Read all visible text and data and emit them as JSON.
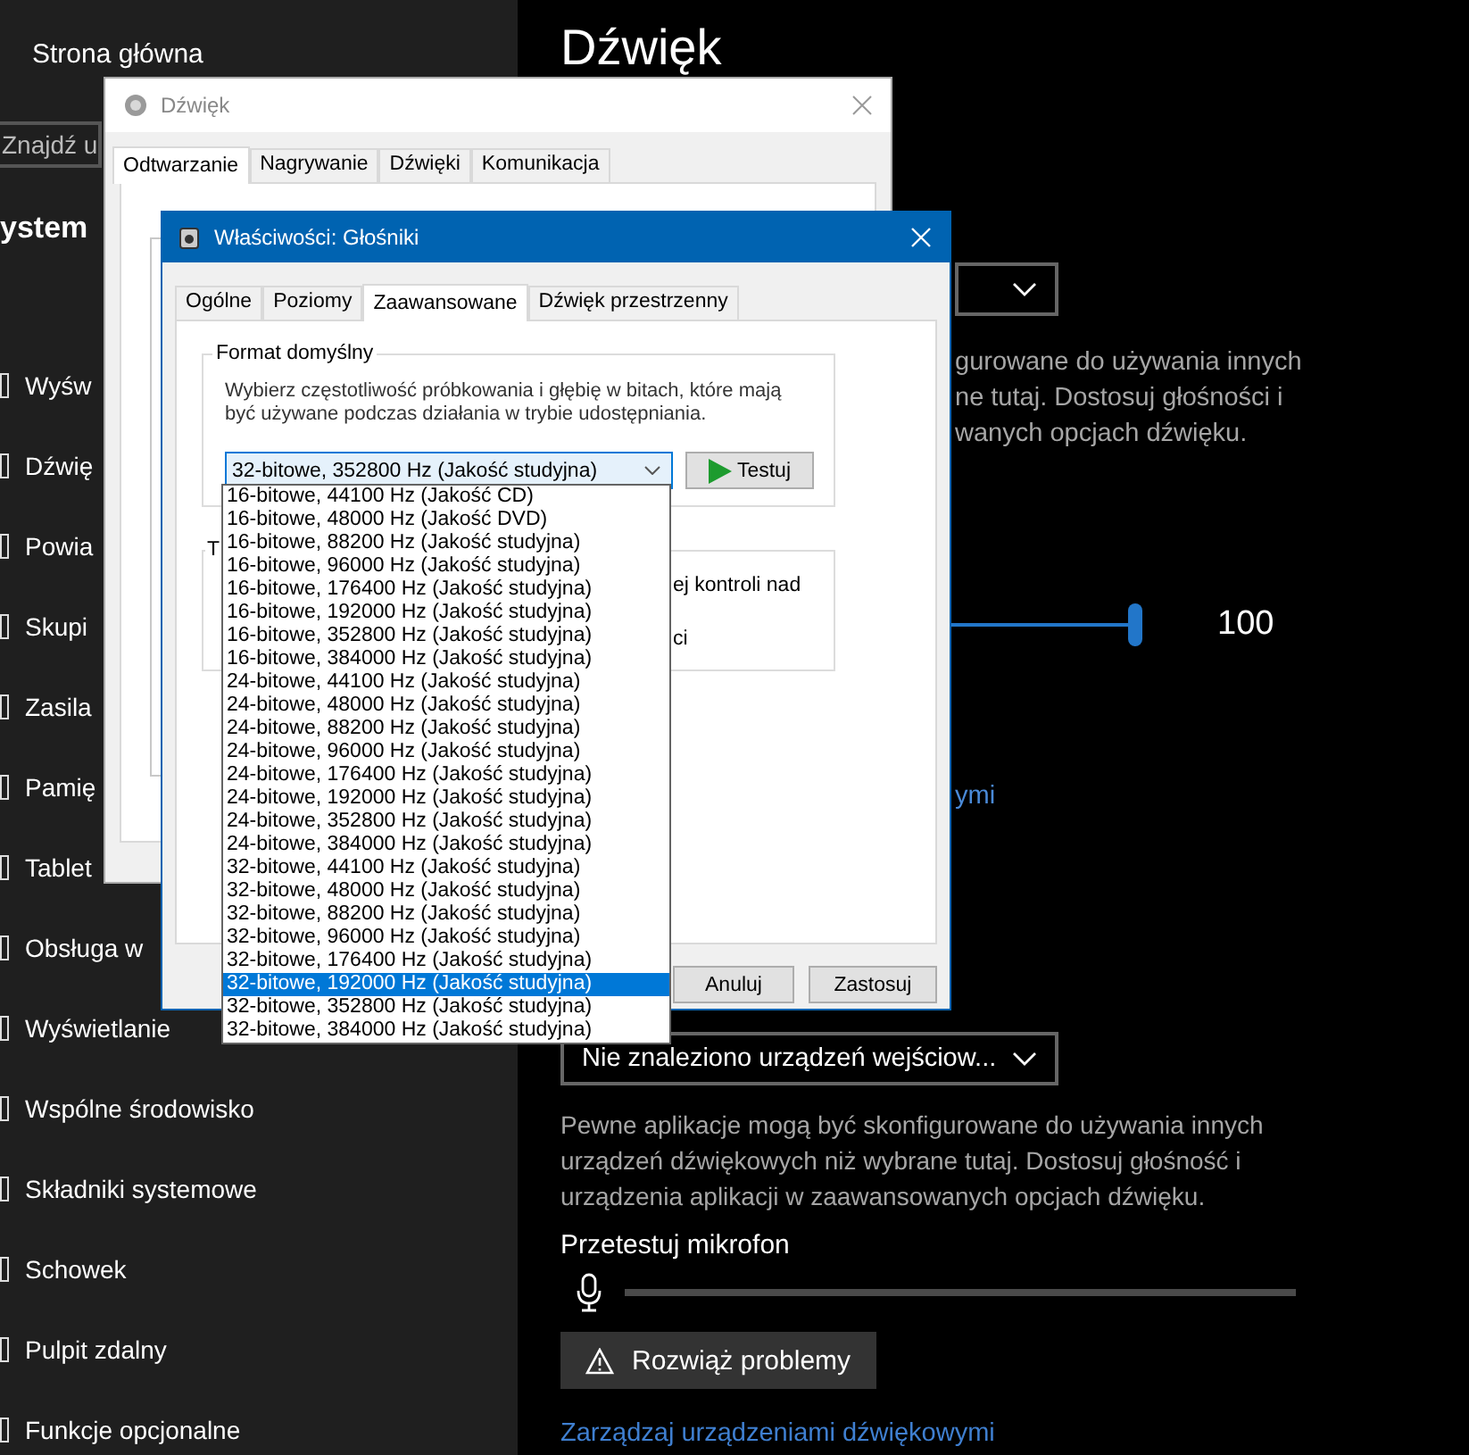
{
  "settings": {
    "home": "Strona główna",
    "search": {
      "placeholder": "Znajdź u"
    },
    "section": "ystem",
    "sidebar_items": [
      "Wyśw",
      "Dźwię",
      "Powia",
      "Skupi",
      "Zasila",
      "Pamię",
      "Tablet",
      "Obsługa w",
      "Wyświetlanie",
      "Wspólne środowisko",
      "Składniki systemowe",
      "Schowek",
      "Pulpit zdalny",
      "Funkcje opcjonalne"
    ],
    "title": "Dźwięk",
    "output_note_lines": [
      "gurowane do używania innych",
      "ne tutaj. Dostosuj głośności i",
      "wanych opcjach dźwięku."
    ],
    "volume": {
      "level": 1,
      "reading": "100"
    },
    "link_fragment": "ymi",
    "input_device": "Nie znaleziono urządzeń wejściow...",
    "input_note": "Pewne aplikacje mogą być skonfigurowane do używania innych urządzeń dźwiękowych niż wybrane tutaj. Dostosuj głośność i urządzenia aplikacji w zaawansowanych opcjach dźwięku.",
    "mic_test": {
      "label": "Przetestuj mikrofon"
    },
    "troubleshoot_button": "Rozwiąż problemy",
    "manage_link": "Zarządzaj urządzeniami dźwiękowymi"
  },
  "sound_window": {
    "title": "Dźwięk",
    "tabs": [
      {
        "label": "Odtwarzanie",
        "selected": true
      },
      {
        "label": "Nagrywanie",
        "selected": false
      },
      {
        "label": "Dźwięki",
        "selected": false
      },
      {
        "label": "Komunikacja",
        "selected": false
      }
    ]
  },
  "properties_window": {
    "title": "Właściwości: Głośniki",
    "tabs": [
      {
        "label": "Ogólne",
        "selected": false
      },
      {
        "label": "Poziomy",
        "selected": false
      },
      {
        "label": "Zaawansowane",
        "selected": true
      },
      {
        "label": "Dźwięk przestrzenny",
        "selected": false
      }
    ],
    "format_group": {
      "legend": "Format domyślny",
      "description": "Wybierz częstotliwość próbkowania i głębię w bitach, które mają być używane podczas działania w trybie udostępniania.",
      "value": "32-bitowe, 352800 Hz (Jakość studyjna)",
      "test_button": "Testuj"
    },
    "exclusive_group": {
      "legend": "T",
      "fragments": [
        "ej kontroli nad",
        "ci"
      ]
    },
    "buttons": [
      "Anuluj",
      "Zastosuj"
    ]
  },
  "format_list": [
    {
      "label": "16-bitowe, 44100 Hz (Jakość CD)",
      "selected": false
    },
    {
      "label": "16-bitowe, 48000 Hz (Jakość DVD)",
      "selected": false
    },
    {
      "label": "16-bitowe, 88200 Hz (Jakość studyjna)",
      "selected": false
    },
    {
      "label": "16-bitowe, 96000 Hz (Jakość studyjna)",
      "selected": false
    },
    {
      "label": "16-bitowe, 176400 Hz (Jakość studyjna)",
      "selected": false
    },
    {
      "label": "16-bitowe, 192000 Hz (Jakość studyjna)",
      "selected": false
    },
    {
      "label": "16-bitowe, 352800 Hz (Jakość studyjna)",
      "selected": false
    },
    {
      "label": "16-bitowe, 384000 Hz (Jakość studyjna)",
      "selected": false
    },
    {
      "label": "24-bitowe, 44100 Hz (Jakość studyjna)",
      "selected": false
    },
    {
      "label": "24-bitowe, 48000 Hz (Jakość studyjna)",
      "selected": false
    },
    {
      "label": "24-bitowe, 88200 Hz (Jakość studyjna)",
      "selected": false
    },
    {
      "label": "24-bitowe, 96000 Hz (Jakość studyjna)",
      "selected": false
    },
    {
      "label": "24-bitowe, 176400 Hz (Jakość studyjna)",
      "selected": false
    },
    {
      "label": "24-bitowe, 192000 Hz (Jakość studyjna)",
      "selected": false
    },
    {
      "label": "24-bitowe, 352800 Hz (Jakość studyjna)",
      "selected": false
    },
    {
      "label": "24-bitowe, 384000 Hz (Jakość studyjna)",
      "selected": false
    },
    {
      "label": "32-bitowe, 44100 Hz (Jakość studyjna)",
      "selected": false
    },
    {
      "label": "32-bitowe, 48000 Hz (Jakość studyjna)",
      "selected": false
    },
    {
      "label": "32-bitowe, 88200 Hz (Jakość studyjna)",
      "selected": false
    },
    {
      "label": "32-bitowe, 96000 Hz (Jakość studyjna)",
      "selected": false
    },
    {
      "label": "32-bitowe, 176400 Hz (Jakość studyjna)",
      "selected": false
    },
    {
      "label": "32-bitowe, 192000 Hz (Jakość studyjna)",
      "selected": true
    },
    {
      "label": "32-bitowe, 352800 Hz (Jakość studyjna)",
      "selected": false
    },
    {
      "label": "32-bitowe, 384000 Hz (Jakość studyjna)",
      "selected": false
    }
  ]
}
